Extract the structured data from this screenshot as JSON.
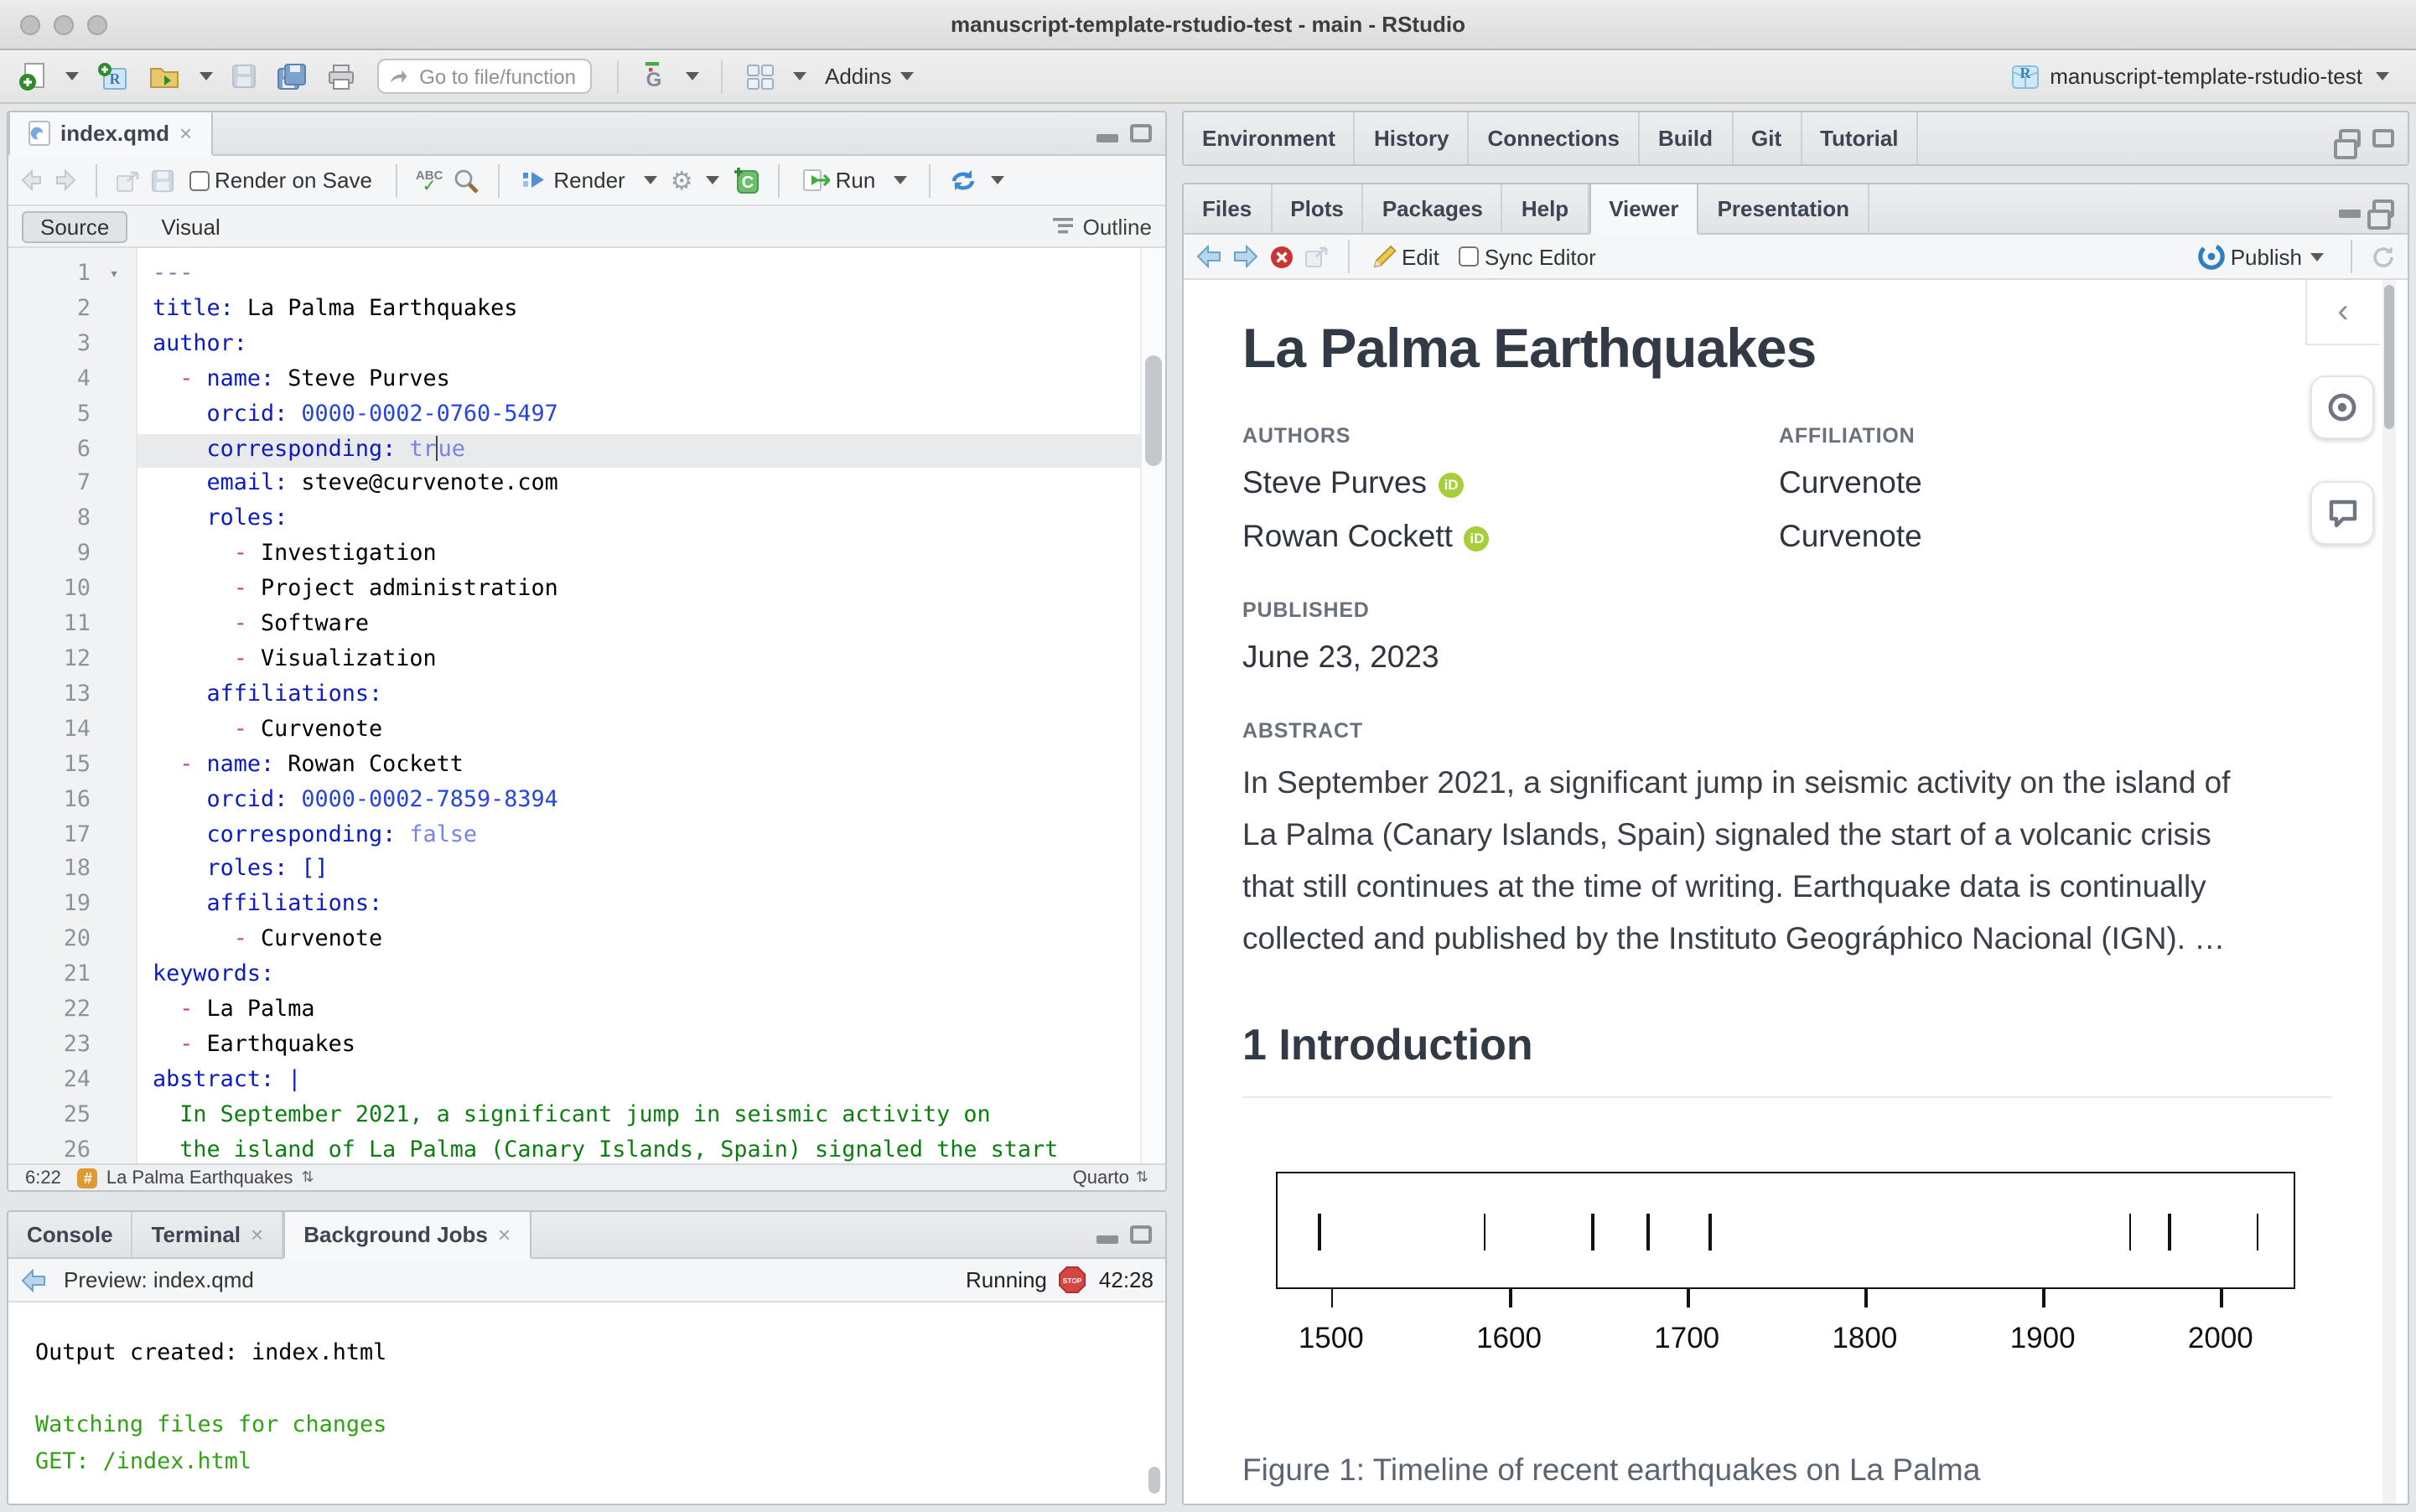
{
  "window": {
    "title": "manuscript-template-rstudio-test - main - RStudio"
  },
  "toolbar": {
    "goto_placeholder": "Go to file/function",
    "addins_label": "Addins",
    "project_label": "manuscript-template-rstudio-test"
  },
  "editor": {
    "tab": "index.qmd",
    "render_on_save": "Render on Save",
    "render_label": "Render",
    "run_label": "Run",
    "source_label": "Source",
    "visual_label": "Visual",
    "outline_label": "Outline",
    "status": {
      "position": "6:22",
      "chunk": "La Palma Earthquakes",
      "format": "Quarto"
    },
    "lines": [
      {
        "fold": true,
        "seg": [
          [
            "meta",
            "---"
          ]
        ]
      },
      {
        "seg": [
          [
            "key",
            "title:"
          ],
          [
            "txt",
            " La Palma Earthquakes"
          ]
        ]
      },
      {
        "seg": [
          [
            "key",
            "author:"
          ]
        ]
      },
      {
        "seg": [
          [
            "txt",
            "  "
          ],
          [
            "dash",
            "-"
          ],
          [
            "txt",
            " "
          ],
          [
            "key",
            "name:"
          ],
          [
            "txt",
            " Steve Purves"
          ]
        ]
      },
      {
        "seg": [
          [
            "txt",
            "    "
          ],
          [
            "key",
            "orcid:"
          ],
          [
            "txt",
            " "
          ],
          [
            "num",
            "0000-0002-0760-5497"
          ]
        ]
      },
      {
        "hl": true,
        "seg": [
          [
            "txt",
            "    "
          ],
          [
            "key",
            "corresponding:"
          ],
          [
            "txt",
            " "
          ],
          [
            "bool",
            "tr"
          ],
          [
            "caret",
            ""
          ],
          [
            "bool",
            "ue"
          ]
        ]
      },
      {
        "seg": [
          [
            "txt",
            "    "
          ],
          [
            "key",
            "email:"
          ],
          [
            "txt",
            " steve@curvenote.com"
          ]
        ]
      },
      {
        "seg": [
          [
            "txt",
            "    "
          ],
          [
            "key",
            "roles:"
          ]
        ]
      },
      {
        "seg": [
          [
            "txt",
            "      "
          ],
          [
            "dash",
            "-"
          ],
          [
            "txt",
            " Investigation"
          ]
        ]
      },
      {
        "seg": [
          [
            "txt",
            "      "
          ],
          [
            "dash",
            "-"
          ],
          [
            "txt",
            " Project administration"
          ]
        ]
      },
      {
        "seg": [
          [
            "txt",
            "      "
          ],
          [
            "dash",
            "-"
          ],
          [
            "txt",
            " Software"
          ]
        ]
      },
      {
        "seg": [
          [
            "txt",
            "      "
          ],
          [
            "dash",
            "-"
          ],
          [
            "txt",
            " Visualization"
          ]
        ]
      },
      {
        "seg": [
          [
            "txt",
            "    "
          ],
          [
            "key",
            "affiliations:"
          ]
        ]
      },
      {
        "seg": [
          [
            "txt",
            "      "
          ],
          [
            "dash",
            "-"
          ],
          [
            "txt",
            " Curvenote"
          ]
        ]
      },
      {
        "seg": [
          [
            "txt",
            "  "
          ],
          [
            "dash",
            "-"
          ],
          [
            "txt",
            " "
          ],
          [
            "key",
            "name:"
          ],
          [
            "txt",
            " Rowan Cockett"
          ]
        ]
      },
      {
        "seg": [
          [
            "txt",
            "    "
          ],
          [
            "key",
            "orcid:"
          ],
          [
            "txt",
            " "
          ],
          [
            "num",
            "0000-0002-7859-8394"
          ]
        ]
      },
      {
        "seg": [
          [
            "txt",
            "    "
          ],
          [
            "key",
            "corresponding:"
          ],
          [
            "txt",
            " "
          ],
          [
            "bool",
            "false"
          ]
        ]
      },
      {
        "seg": [
          [
            "txt",
            "    "
          ],
          [
            "key",
            "roles:"
          ],
          [
            "txt",
            " "
          ],
          [
            "key",
            "[]"
          ]
        ]
      },
      {
        "seg": [
          [
            "txt",
            "    "
          ],
          [
            "key",
            "affiliations:"
          ]
        ]
      },
      {
        "seg": [
          [
            "txt",
            "      "
          ],
          [
            "dash",
            "-"
          ],
          [
            "txt",
            " Curvenote"
          ]
        ]
      },
      {
        "seg": [
          [
            "key",
            "keywords:"
          ]
        ]
      },
      {
        "seg": [
          [
            "txt",
            "  "
          ],
          [
            "dash",
            "-"
          ],
          [
            "txt",
            " La Palma"
          ]
        ]
      },
      {
        "seg": [
          [
            "txt",
            "  "
          ],
          [
            "dash",
            "-"
          ],
          [
            "txt",
            " Earthquakes"
          ]
        ]
      },
      {
        "seg": [
          [
            "key",
            "abstract:"
          ],
          [
            "txt",
            " "
          ],
          [
            "key",
            "|"
          ]
        ]
      },
      {
        "seg": [
          [
            "str",
            "  In September 2021, a significant jump in seismic activity on"
          ]
        ]
      },
      {
        "seg": [
          [
            "str",
            "  the island of La Palma (Canary Islands, Spain) signaled the start"
          ]
        ]
      }
    ]
  },
  "console": {
    "tabs": [
      "Console",
      "Terminal",
      "Background Jobs"
    ],
    "preview_label": "Preview: index.qmd",
    "running_label": "Running",
    "stop_label": "STOP",
    "elapsed": "42:28",
    "lines": [
      {
        "t": "Output created: index.html",
        "c": "plain"
      },
      {
        "t": "",
        "c": "plain"
      },
      {
        "t": "Watching files for changes",
        "c": "green"
      },
      {
        "t": "GET: /index.html",
        "c": "green"
      }
    ]
  },
  "envpane": {
    "tabs": [
      "Environment",
      "History",
      "Connections",
      "Build",
      "Git",
      "Tutorial"
    ]
  },
  "filespane": {
    "tabs": [
      "Files",
      "Plots",
      "Packages",
      "Help",
      "Viewer",
      "Presentation"
    ],
    "edit_label": "Edit",
    "sync_label": "Sync Editor",
    "publish_label": "Publish"
  },
  "viewer": {
    "title": "La Palma Earthquakes",
    "authors_label": "AUTHORS",
    "affiliation_label": "AFFILIATION",
    "authors": [
      {
        "name": "Steve Purves",
        "affiliation": "Curvenote"
      },
      {
        "name": "Rowan Cockett",
        "affiliation": "Curvenote"
      }
    ],
    "orcid_glyph": "iD",
    "published_label": "PUBLISHED",
    "published": "June 23, 2023",
    "abstract_label": "ABSTRACT",
    "abstract_lines": [
      "In September 2021, a significant jump in seismic activity on the island of",
      "La Palma (Canary Islands, Spain) signaled the start of a volcanic crisis",
      "that still continues at the time of writing. Earthquake data is continually",
      "collected and published by the Instituto Geográphico Nacional (IGN). …"
    ],
    "section_heading": "1 Introduction",
    "caption": "Figure 1: Timeline of recent earthquakes on La Palma",
    "figure": {
      "xlim": [
        1469,
        2042
      ],
      "events": [
        1492,
        1585,
        1646,
        1677,
        1712,
        1949,
        1971,
        2021
      ],
      "ticks": [
        1500,
        1600,
        1700,
        1800,
        1900,
        2000
      ]
    }
  },
  "chart_data": {
    "type": "scatter",
    "title": "Figure 1: Timeline of recent earthquakes on La Palma",
    "x": [
      1492,
      1585,
      1646,
      1677,
      1712,
      1949,
      1971,
      2021
    ],
    "xticks": [
      1500,
      1600,
      1700,
      1800,
      1900,
      2000
    ],
    "xlim": [
      1469,
      2042
    ],
    "xlabel": "",
    "ylabel": "",
    "legend": false,
    "grid": false
  },
  "colors": {
    "accent_blue": "#3a88d8",
    "orcid_green": "#a6ce39",
    "console_green": "#33a016",
    "stop_red": "#cc3333",
    "yaml_key": "#0b1bc0",
    "yaml_bool": "#7583e8",
    "yaml_dash": "#cc3a9d",
    "yaml_string": "#0d7d11"
  }
}
